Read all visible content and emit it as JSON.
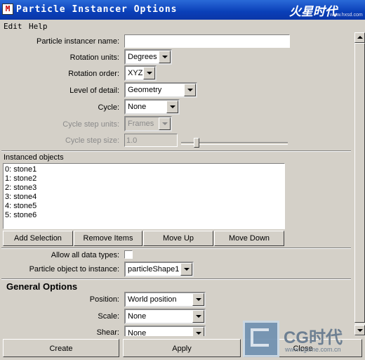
{
  "window": {
    "title": "Particle Instancer Options",
    "app_icon_glyph": "M",
    "brand": "火星时代",
    "brand_url": "www.hxsd.com"
  },
  "menu": {
    "edit": "Edit",
    "help": "Help"
  },
  "form": {
    "instancer_name": {
      "label": "Particle instancer name:",
      "value": ""
    },
    "rotation_units": {
      "label": "Rotation units:",
      "value": "Degrees"
    },
    "rotation_order": {
      "label": "Rotation order:",
      "value": "XYZ"
    },
    "level_of_detail": {
      "label": "Level of detail:",
      "value": "Geometry"
    },
    "cycle": {
      "label": "Cycle:",
      "value": "None"
    },
    "cycle_step_units": {
      "label": "Cycle step units:",
      "value": "Frames"
    },
    "cycle_step_size": {
      "label": "Cycle step size:",
      "value": "1.0"
    }
  },
  "instanced_objects": {
    "label": "Instanced objects",
    "items": [
      "0: stone1",
      "1: stone2",
      "2: stone3",
      "3: stone4",
      "4: stone5",
      "5: stone6"
    ]
  },
  "list_buttons": {
    "add_selection": "Add Selection",
    "remove_items": "Remove Items",
    "move_up": "Move Up",
    "move_down": "Move Down"
  },
  "data_types": {
    "allow_all_label": "Allow all data types:",
    "particle_object_label": "Particle object to instance:",
    "particle_object_value": "particleShape1"
  },
  "general_options": {
    "heading": "General Options",
    "position": {
      "label": "Position:",
      "value": "World position"
    },
    "scale": {
      "label": "Scale:",
      "value": "None"
    },
    "shear": {
      "label": "Shear:",
      "value": "None"
    }
  },
  "bottom_buttons": {
    "create": "Create",
    "apply": "Apply",
    "close": "Close"
  },
  "watermark": {
    "title": "CG时代",
    "url": "www.cgtime.com.cn"
  },
  "colors": {
    "titlebar": "#0a3fb8",
    "window_bg": "#d4d0c8"
  }
}
